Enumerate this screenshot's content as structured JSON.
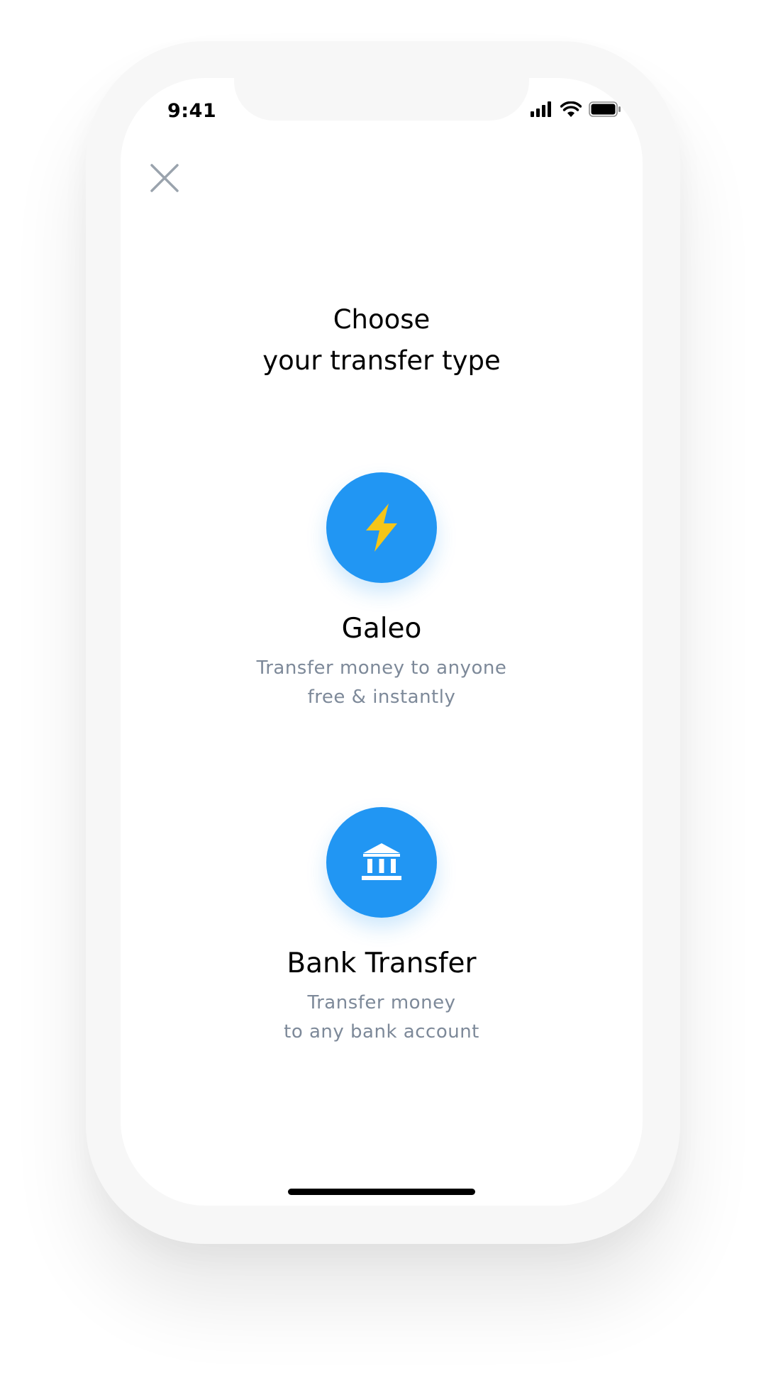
{
  "status_bar": {
    "time": "9:41"
  },
  "header": {
    "title_line1": "Choose",
    "title_line2": "your transfer type"
  },
  "options": [
    {
      "title": "Galeo",
      "desc_line1": "Transfer money to anyone",
      "desc_line2": "free & instantly",
      "icon": "lightning-bolt-icon",
      "icon_color": "#f5c518"
    },
    {
      "title": "Bank Transfer",
      "desc_line1": "Transfer money",
      "desc_line2": "to any bank account",
      "icon": "bank-icon",
      "icon_color": "#ffffff"
    }
  ],
  "colors": {
    "accent": "#2196f3",
    "secondary_text": "#7d8999",
    "close_icon": "#9aa3ad"
  }
}
